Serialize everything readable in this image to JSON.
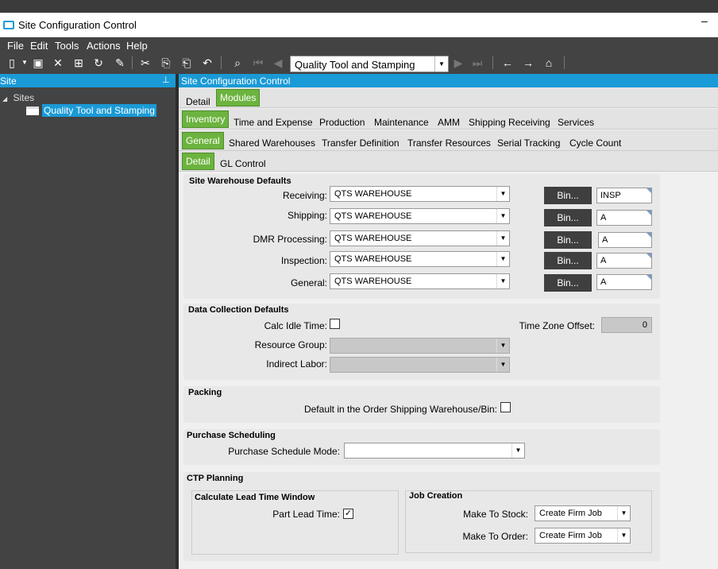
{
  "window": {
    "title": "Site Configuration Control",
    "min": "–"
  },
  "menu": [
    "File",
    "Edit",
    "Tools",
    "Actions",
    "Help"
  ],
  "toolbar": {
    "site_combo": "Quality Tool and Stamping"
  },
  "left": {
    "header": "Site",
    "pin": "📌",
    "tree_root": "Sites",
    "tree_item": "Quality Tool and Stamping"
  },
  "right": {
    "header": "Site Configuration Control"
  },
  "tabs": {
    "row1": [
      "Detail",
      "Modules"
    ],
    "row2": [
      "Inventory",
      "Time and Expense",
      "Production",
      "Maintenance",
      "AMM",
      "Shipping Receiving",
      "Services"
    ],
    "row3": [
      "General",
      "Shared Warehouses",
      "Transfer Definition",
      "Transfer Resources",
      "Serial Tracking",
      "Cycle Count"
    ],
    "row4": [
      "Detail",
      "GL Control"
    ]
  },
  "warehouse": {
    "title": "Site Warehouse Defaults",
    "bin_label": "Bin...",
    "rows": [
      {
        "label": "Receiving:",
        "value": "QTS WAREHOUSE",
        "bin": "INSP"
      },
      {
        "label": "Shipping:",
        "value": "QTS WAREHOUSE",
        "bin": "A"
      },
      {
        "label": "DMR Processing:",
        "value": "QTS WAREHOUSE",
        "bin": "A"
      },
      {
        "label": "Inspection:",
        "value": "QTS WAREHOUSE",
        "bin": "A"
      },
      {
        "label": "General:",
        "value": "QTS WAREHOUSE",
        "bin": "A"
      }
    ]
  },
  "datacol": {
    "title": "Data Collection Defaults",
    "calc_idle": "Calc Idle Time:",
    "tz_label": "Time Zone Offset:",
    "tz_value": "0",
    "resource_group": "Resource Group:",
    "indirect_labor": "Indirect Labor:"
  },
  "packing": {
    "title": "Packing",
    "default_label": "Default in the Order Shipping Warehouse/Bin:"
  },
  "purchase": {
    "title": "Purchase Scheduling",
    "mode_label": "Purchase Schedule Mode:",
    "mode_value": ""
  },
  "ctp": {
    "title": "CTP Planning",
    "lead_title": "Calculate Lead Time Window",
    "part_lead": "Part Lead Time:",
    "part_lead_checked": true,
    "job_title": "Job Creation",
    "make_stock": "Make To Stock:",
    "make_stock_value": "Create Firm Job",
    "make_order": "Make To Order:",
    "make_order_value": "Create Firm Job"
  },
  "colors": {
    "accent": "#1a9ad6",
    "tab_active": "#6cb33f",
    "dark": "#434343"
  }
}
